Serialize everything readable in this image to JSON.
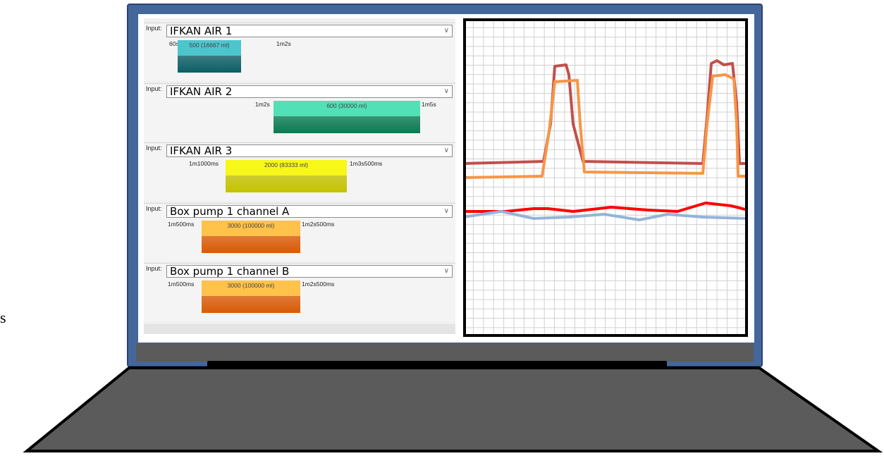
{
  "page": {
    "stray_text": "s"
  },
  "inputs": {
    "label": "Input:",
    "rows": [
      {
        "name": "IFKAN AIR 1",
        "start": "60s",
        "volume": "500 (16667 ml)",
        "end": "1m2s",
        "color_top": "#4dc5cc",
        "color_bottom": "#0c5e66"
      },
      {
        "name": "IFKAN AIR 2",
        "start": "1m2s",
        "volume": "600 (30000 ml)",
        "end": "1m5s",
        "color_top": "#52e0b6",
        "color_bottom": "#0a7a52"
      },
      {
        "name": "IFKAN AIR 3",
        "start": "1m1000ms",
        "volume": "2000 (83333 ml)",
        "end": "1m3s500ms",
        "color_top": "#f7f71a",
        "color_bottom": "#c4c200"
      },
      {
        "name": "Box pump 1 channel A",
        "start": "1m500ms",
        "volume": "3000 (100000 ml)",
        "end": "1m2s500ms",
        "color_top": "#ffc24a",
        "color_bottom": "#d95a06"
      },
      {
        "name": "Box pump 1 channel B",
        "start": "1m500ms",
        "volume": "3000 (100000 ml)",
        "end": "1m2s500ms",
        "color_top": "#ffc24a",
        "color_bottom": "#d95a06"
      }
    ]
  },
  "graph": {
    "colors": {
      "line1": "#c0504d",
      "line2": "#f79646",
      "line3": "#ff0000",
      "line4": "#95b3d7",
      "grid": "#d0d0d0",
      "frame": "#000000"
    }
  },
  "laptop": {
    "colors": {
      "bezel": "#44679b",
      "bezel_edge": "#2c4470",
      "chin": "#5b5b5b",
      "base": "#5b5b5b",
      "hinge": "#000000"
    }
  }
}
